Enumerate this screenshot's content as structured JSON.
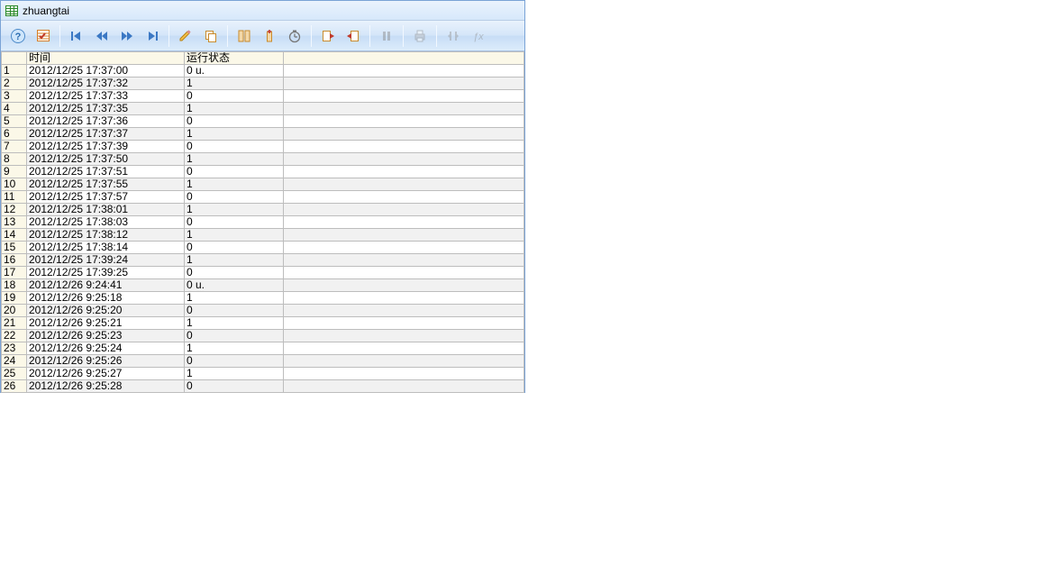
{
  "window": {
    "title": "zhuangtai"
  },
  "columns": {
    "time": "时间",
    "status": "运行状态"
  },
  "toolbar": {
    "help": "help-icon",
    "table_opts": "table-check-icon",
    "first": "first-record-icon",
    "prev": "prev-record-icon",
    "next": "next-record-icon",
    "last": "last-record-icon",
    "edit": "edit-icon",
    "copy": "copy-icon",
    "columns": "columns-icon",
    "insert_col": "insert-column-icon",
    "time_span": "time-span-icon",
    "import": "import-icon",
    "export": "export-icon",
    "pause": "pause-icon",
    "print": "print-icon",
    "expand": "expand-icon",
    "fx": "function-icon"
  },
  "rows": [
    {
      "n": 1,
      "time": "2012/12/25 17:37:00",
      "status": "0 u."
    },
    {
      "n": 2,
      "time": "2012/12/25 17:37:32",
      "status": "1"
    },
    {
      "n": 3,
      "time": "2012/12/25 17:37:33",
      "status": "0"
    },
    {
      "n": 4,
      "time": "2012/12/25 17:37:35",
      "status": "1"
    },
    {
      "n": 5,
      "time": "2012/12/25 17:37:36",
      "status": "0"
    },
    {
      "n": 6,
      "time": "2012/12/25 17:37:37",
      "status": "1"
    },
    {
      "n": 7,
      "time": "2012/12/25 17:37:39",
      "status": "0"
    },
    {
      "n": 8,
      "time": "2012/12/25 17:37:50",
      "status": "1"
    },
    {
      "n": 9,
      "time": "2012/12/25 17:37:51",
      "status": "0"
    },
    {
      "n": 10,
      "time": "2012/12/25 17:37:55",
      "status": "1"
    },
    {
      "n": 11,
      "time": "2012/12/25 17:37:57",
      "status": "0"
    },
    {
      "n": 12,
      "time": "2012/12/25 17:38:01",
      "status": "1"
    },
    {
      "n": 13,
      "time": "2012/12/25 17:38:03",
      "status": "0"
    },
    {
      "n": 14,
      "time": "2012/12/25 17:38:12",
      "status": "1"
    },
    {
      "n": 15,
      "time": "2012/12/25 17:38:14",
      "status": "0"
    },
    {
      "n": 16,
      "time": "2012/12/25 17:39:24",
      "status": "1"
    },
    {
      "n": 17,
      "time": "2012/12/25 17:39:25",
      "status": "0"
    },
    {
      "n": 18,
      "time": "2012/12/26 9:24:41",
      "status": "0 u."
    },
    {
      "n": 19,
      "time": "2012/12/26 9:25:18",
      "status": "1"
    },
    {
      "n": 20,
      "time": "2012/12/26 9:25:20",
      "status": "0"
    },
    {
      "n": 21,
      "time": "2012/12/26 9:25:21",
      "status": "1"
    },
    {
      "n": 22,
      "time": "2012/12/26 9:25:23",
      "status": "0"
    },
    {
      "n": 23,
      "time": "2012/12/26 9:25:24",
      "status": "1"
    },
    {
      "n": 24,
      "time": "2012/12/26 9:25:26",
      "status": "0"
    },
    {
      "n": 25,
      "time": "2012/12/26 9:25:27",
      "status": "1"
    },
    {
      "n": 26,
      "time": "2012/12/26 9:25:28",
      "status": "0"
    }
  ]
}
